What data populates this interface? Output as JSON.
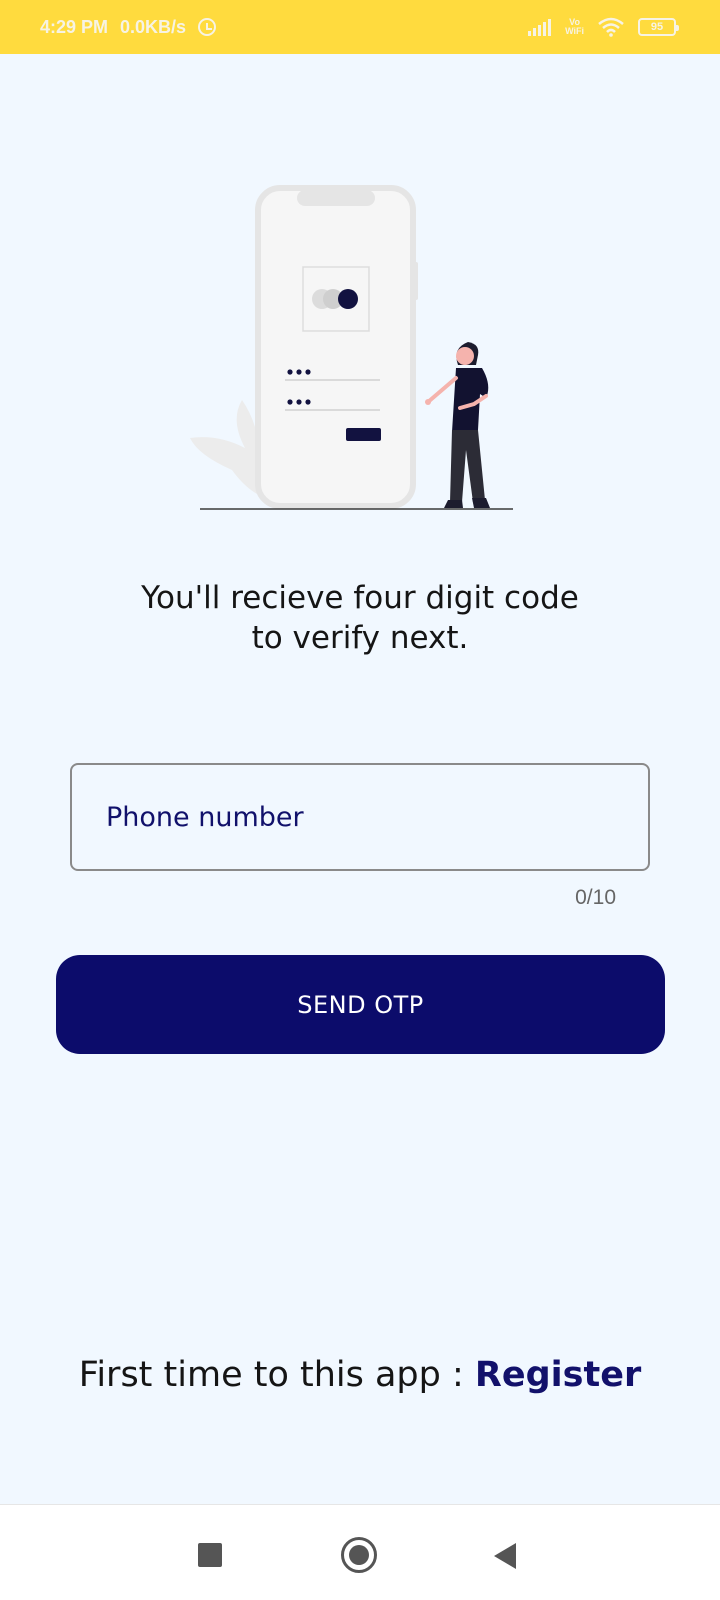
{
  "status_bar": {
    "time": "4:29 PM",
    "speed": "0.0KB/s",
    "vowifi_top": "Vo",
    "vowifi_bottom": "WiFi",
    "battery": "95"
  },
  "headline": {
    "line1": "You'll recieve four digit code",
    "line2": "to verify next."
  },
  "phone_field": {
    "placeholder": "Phone number",
    "value": "",
    "counter": "0/10"
  },
  "send_button": {
    "label": "SEND OTP"
  },
  "register": {
    "prompt": "First time to this app : ",
    "link_label": "Register"
  },
  "colors": {
    "accent": "#0c0c6b",
    "status_bar": "#ffdb3e",
    "background": "#f1f8ff"
  },
  "icons": {
    "alarm": "alarm-icon",
    "signal": "signal-icon",
    "wifi": "wifi-icon",
    "battery": "battery-icon",
    "nav_recents": "square-icon",
    "nav_home": "circle-icon",
    "nav_back": "triangle-back-icon"
  }
}
